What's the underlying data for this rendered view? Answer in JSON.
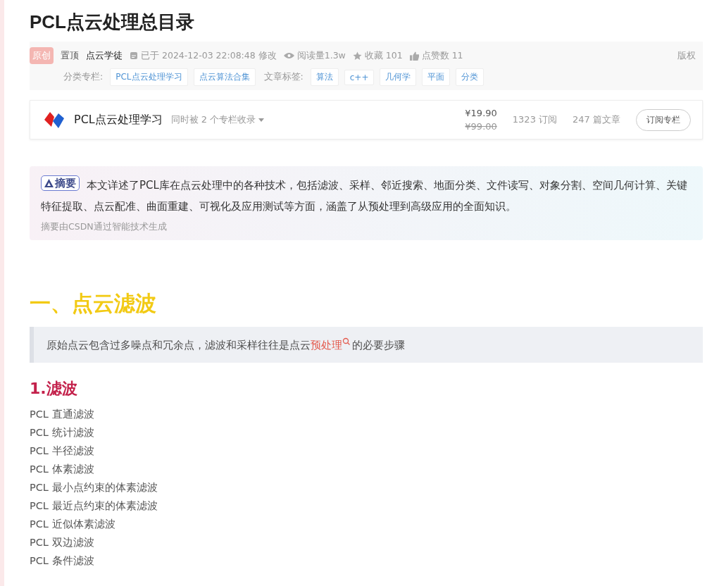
{
  "article": {
    "title": "PCL点云处理总目录",
    "meta": {
      "badge": "原创",
      "pinned": "置顶",
      "author": "点云学徒",
      "modified": "已于 2024-12-03 22:08:48 修改",
      "views": "阅读量1.3w",
      "favorites": "收藏 101",
      "likes": "点赞数 11",
      "copyright": "版权",
      "column_label": "分类专栏:",
      "columns": [
        "PCL点云处理学习",
        "点云算法合集"
      ],
      "tag_label": "文章标签:",
      "tags": [
        "算法",
        "c++",
        "几何学",
        "平面",
        "分类"
      ]
    },
    "column_card": {
      "name": "PCL点云处理学习",
      "also": "同时被 2 个专栏收录",
      "price": "¥19.90",
      "original_price": "¥99.00",
      "subscribers": "1323 订阅",
      "articles": "247 篇文章",
      "button": "订阅专栏"
    },
    "summary": {
      "badge": "摘要",
      "text": "本文详述了PCL库在点云处理中的各种技术，包括滤波、采样、邻近搜索、地面分类、文件读写、对象分割、空间几何计算、关键特征提取、点云配准、曲面重建、可视化及应用测试等方面，涵盖了从预处理到高级应用的全面知识。",
      "note": "摘要由CSDN通过智能技术生成"
    },
    "section_heading": "一、点云滤波",
    "quote": {
      "before": "原始点云包含过多噪点和冗余点，滤波和采样往往是点云",
      "link": "预处理",
      "after": "的必要步骤"
    },
    "sub_heading": "1.滤波",
    "items": [
      "PCL 直通滤波",
      "PCL 统计滤波",
      "PCL 半径滤波",
      "PCL 体素滤波",
      "PCL 最小点约束的体素滤波",
      "PCL 最近点约束的体素滤波",
      "PCL 近似体素滤波",
      "PCL 双边滤波",
      "PCL 条件滤波"
    ]
  }
}
